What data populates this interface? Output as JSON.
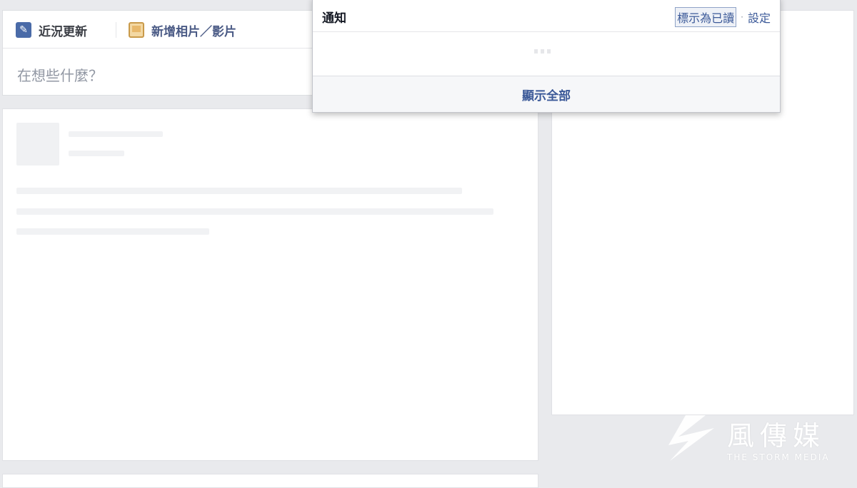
{
  "composer": {
    "tabs": [
      {
        "label": "近況更新",
        "icon": "pencil-icon"
      },
      {
        "label": "新增相片／影片",
        "icon": "photo-icon"
      }
    ],
    "placeholder": "在想些什麼？"
  },
  "notifications": {
    "title": "通知",
    "mark_read_label": "標示為已讀",
    "separator": "·",
    "settings_label": "設定",
    "show_all_label": "顯示全部"
  },
  "watermark": {
    "name_cn": "風傳媒",
    "name_en": "THE STORM MEDIA"
  },
  "colors": {
    "link": "#3b5998",
    "background": "#e9eaed"
  }
}
